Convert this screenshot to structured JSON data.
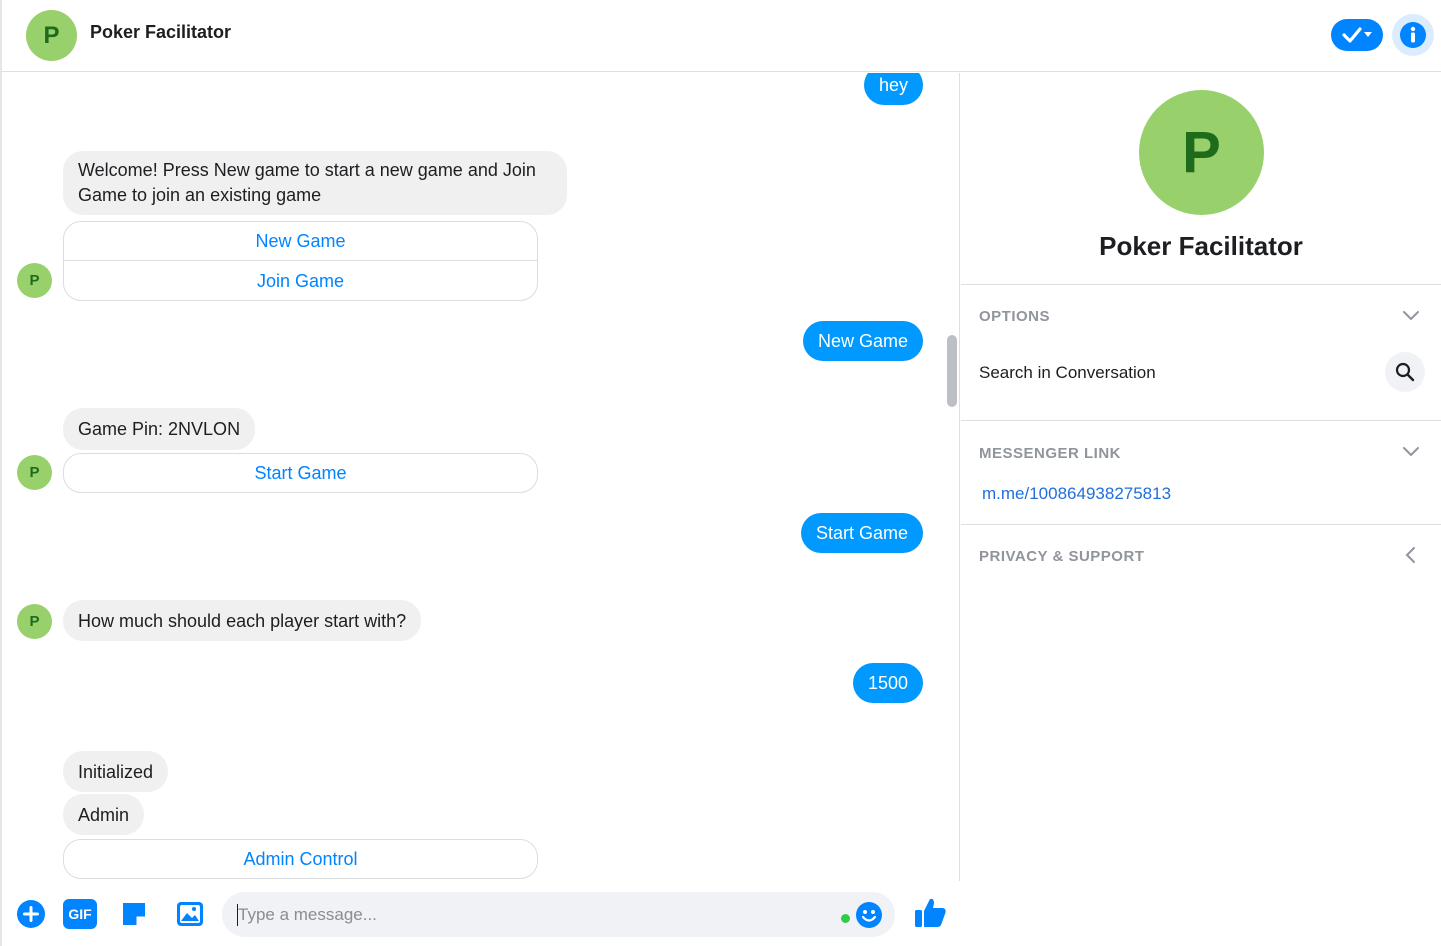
{
  "header": {
    "avatar_letter": "P",
    "title": "Poker Facilitator"
  },
  "conversation": {
    "messages": [
      {
        "from": "me",
        "text": "hey"
      },
      {
        "from": "bot",
        "text": "Welcome! Press New game to start a new game and Join Game to join an existing game",
        "buttons": [
          "New Game",
          "Join Game"
        ]
      },
      {
        "from": "me",
        "text": "New Game"
      },
      {
        "from": "bot",
        "text": "Game Pin: 2NVLON",
        "buttons": [
          "Start Game"
        ]
      },
      {
        "from": "me",
        "text": "Start Game"
      },
      {
        "from": "bot",
        "text": "How much should each player start with?"
      },
      {
        "from": "me",
        "text": "1500"
      },
      {
        "from": "bot",
        "text": "Initialized"
      },
      {
        "from": "bot",
        "text": "Admin",
        "buttons": [
          "Admin Control"
        ]
      }
    ],
    "bot_avatar_letter": "P",
    "welcome_line1": "Welcome! Press New game to start a new game and Join",
    "welcome_line2": "Game to join an existing game"
  },
  "composer": {
    "placeholder": "Type a message...",
    "gif_label": "GIF"
  },
  "panel": {
    "avatar_letter": "P",
    "name": "Poker Facilitator",
    "options_title": "OPTIONS",
    "search_label": "Search in Conversation",
    "messenger_link_title": "MESSENGER LINK",
    "messenger_link": "m.me/100864938275813",
    "privacy_title": "PRIVACY & SUPPORT"
  },
  "colors": {
    "accent": "#0084ff",
    "outgoing_bubble": "#0099ff",
    "incoming_bubble": "#f1f0f0",
    "avatar_green": "#98d06c",
    "avatar_letter": "#1e6b1b"
  },
  "icons": [
    "check-icon",
    "info-icon",
    "plus-icon",
    "gif-icon",
    "sticker-icon",
    "image-icon",
    "smile-icon",
    "thumbs-up-icon",
    "search-icon",
    "chevron-down-icon",
    "chevron-left-icon"
  ]
}
